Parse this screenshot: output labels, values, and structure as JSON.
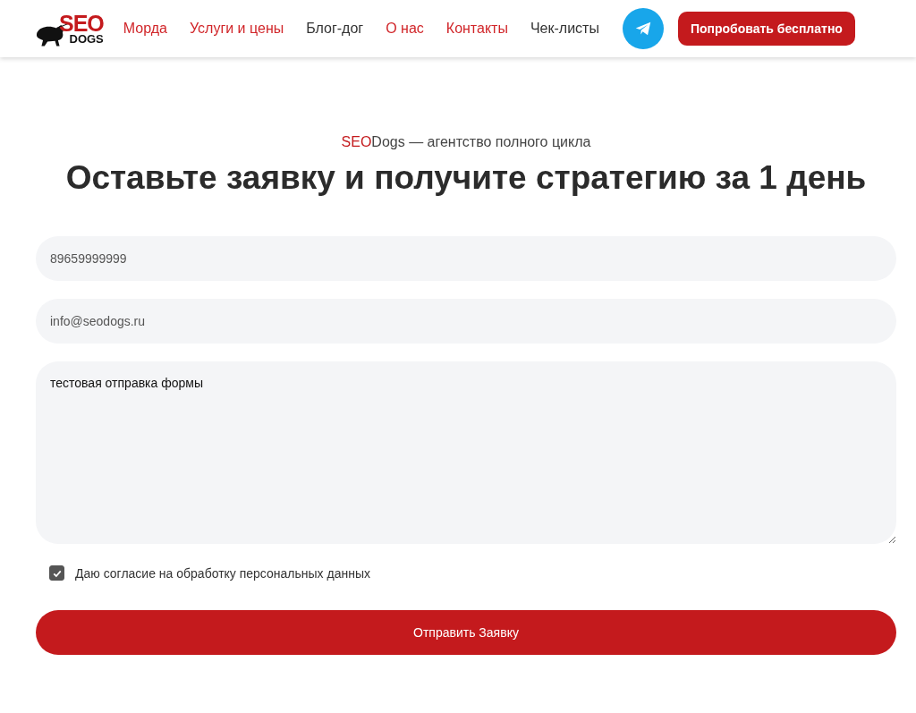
{
  "logo": {
    "top": "SEO",
    "bottom": "DOGS"
  },
  "nav": [
    {
      "label": "Морда",
      "accent": true
    },
    {
      "label": "Услуги и цены",
      "accent": true
    },
    {
      "label": "Блог-дог",
      "accent": false
    },
    {
      "label": "О нас",
      "accent": true
    },
    {
      "label": "Контакты",
      "accent": true
    },
    {
      "label": "Чек-листы",
      "accent": false
    }
  ],
  "cta": "Попробовать бесплатно",
  "tagline": {
    "accent": "SEO",
    "rest": "Dogs — агентство полного цикла"
  },
  "heading": "Оставьте заявку и получите стратегию за 1 день",
  "form": {
    "phone": "89659999999",
    "email": "info@seodogs.ru",
    "message": "тестовая отправка формы",
    "consent": {
      "label": "Даю согласие на обработку персональных данных",
      "checked": true
    },
    "submit": "Отправить Заявку"
  }
}
